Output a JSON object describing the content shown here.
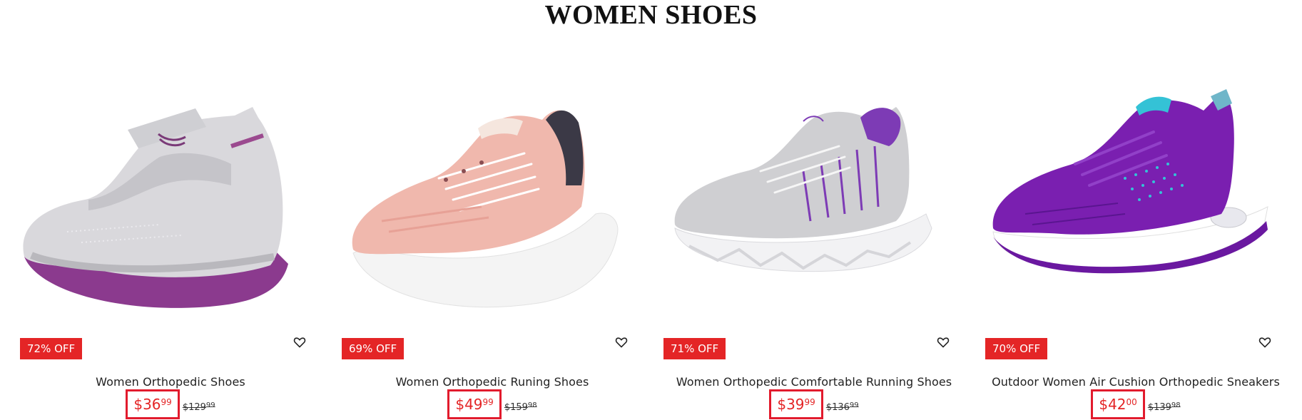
{
  "section": {
    "title": "WOMEN SHOES"
  },
  "products": [
    {
      "name": "Women Orthopedic Shoes",
      "badge": "72% OFF",
      "price_dollars": "$36",
      "price_cents": "99",
      "compare_dollars": "$129",
      "compare_cents": "99",
      "image_icon": "shoe-image",
      "colors": {
        "upper": "#d9d8dc",
        "knit": "#c5c4c9",
        "sole": "#8b3a8e",
        "accent": "#9b4a8f"
      }
    },
    {
      "name": "Women Orthopedic Runing Shoes",
      "badge": "69% OFF",
      "price_dollars": "$49",
      "price_cents": "99",
      "compare_dollars": "$159",
      "compare_cents": "98",
      "image_icon": "shoe-image",
      "colors": {
        "upper": "#f0b8ad",
        "knit": "#e7a196",
        "sole": "#f4f4f4",
        "accent": "#3b3946"
      }
    },
    {
      "name": "Women Orthopedic Comfortable Running Shoes",
      "badge": "71% OFF",
      "price_dollars": "$39",
      "price_cents": "99",
      "compare_dollars": "$136",
      "compare_cents": "99",
      "image_icon": "shoe-image",
      "colors": {
        "upper": "#cfcfd2",
        "knit": "#bdbcc1",
        "sole": "#f2f2f4",
        "accent": "#7d3bb5"
      }
    },
    {
      "name": "Outdoor Women Air Cushion Orthopedic Sneakers",
      "badge": "70% OFF",
      "price_dollars": "$42",
      "price_cents": "00",
      "compare_dollars": "$139",
      "compare_cents": "98",
      "image_icon": "shoe-image",
      "colors": {
        "upper": "#7a1fb0",
        "knit": "#6a18a0",
        "sole": "#ffffff",
        "accent": "#34c2d6"
      }
    }
  ],
  "icons": {
    "wishlist": "heart-outline-icon"
  },
  "theme": {
    "sale_red": "#e42526",
    "price_border": "#e21b2d"
  }
}
